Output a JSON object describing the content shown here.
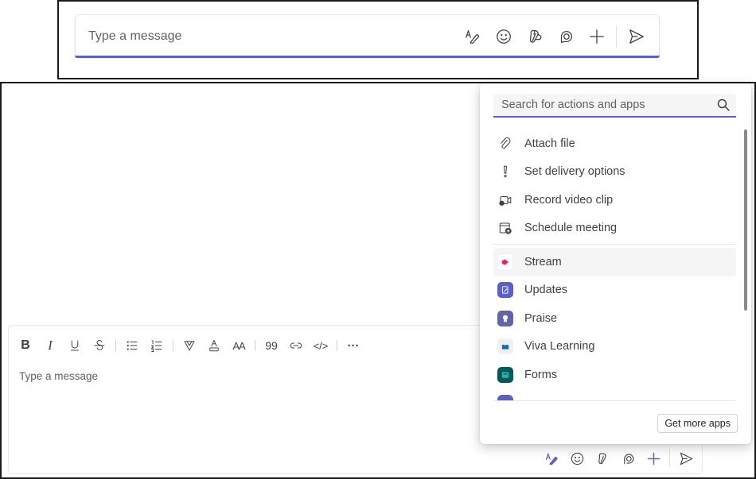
{
  "compact_composer": {
    "placeholder": "Type a message",
    "actions": [
      {
        "name": "format-icon",
        "label": "Format"
      },
      {
        "name": "emoji-icon",
        "label": "Emoji"
      },
      {
        "name": "loop-icon",
        "label": "Loop components"
      },
      {
        "name": "copilot-icon",
        "label": "Copilot"
      },
      {
        "name": "plus-icon",
        "label": "Actions and apps"
      },
      {
        "name": "send-icon",
        "label": "Send"
      }
    ]
  },
  "expanded_composer": {
    "placeholder": "Type a message",
    "format_toolbar": [
      "Bold",
      "Italic",
      "Underline",
      "Strikethrough",
      "Bulleted list",
      "Numbered list",
      "Highlight",
      "Font color",
      "Font size",
      "Quote",
      "Insert link",
      "Code snippet",
      "More options"
    ],
    "format_glyphs": {
      "bold": "B",
      "italic": "I",
      "underline": "U",
      "strike": "S",
      "fontsize": "AA",
      "quote": "99",
      "code": "</>",
      "more": "···"
    },
    "accent_color": "#5b5fc7"
  },
  "actions_popup": {
    "search_placeholder": "Search for actions and apps",
    "actions": [
      {
        "label": "Attach file",
        "icon": "paperclip-icon"
      },
      {
        "label": "Set delivery options",
        "icon": "exclamation-icon"
      },
      {
        "label": "Record video clip",
        "icon": "video-clip-icon"
      },
      {
        "label": "Schedule meeting",
        "icon": "calendar-add-icon"
      }
    ],
    "apps": [
      {
        "label": "Stream",
        "icon": "stream-icon",
        "color": "#e3216d",
        "hovered": true
      },
      {
        "label": "Updates",
        "icon": "updates-icon",
        "color": "#5b5fc7"
      },
      {
        "label": "Praise",
        "icon": "praise-icon",
        "color": "#6264a7"
      },
      {
        "label": "Viva Learning",
        "icon": "viva-learning-icon",
        "color": "#0f6cbd"
      },
      {
        "label": "Forms",
        "icon": "forms-icon",
        "color": "#035a5a"
      }
    ],
    "get_more_apps_label": "Get more apps"
  }
}
